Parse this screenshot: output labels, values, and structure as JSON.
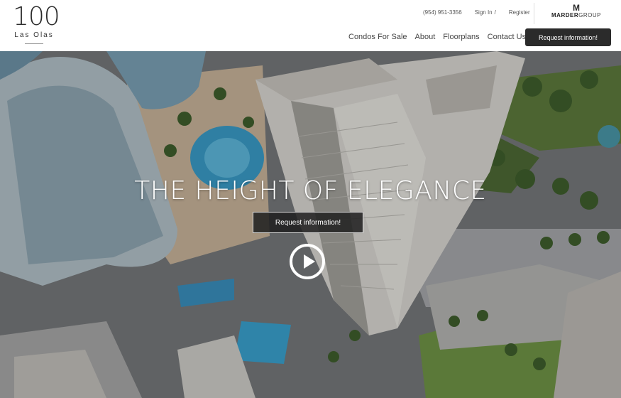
{
  "logo": {
    "number": "100",
    "name": "Las Olas"
  },
  "top_links": {
    "phone": "(954) 951-3356",
    "sign_in": "Sign In",
    "separator": "/",
    "register": "Register"
  },
  "brand": {
    "name_bold": "MARDER",
    "name_rest": "GROUP"
  },
  "nav": {
    "items": [
      "Condos For Sale",
      "About",
      "Floorplans",
      "Contact Us"
    ],
    "cta": "Request information!"
  },
  "hero": {
    "headline": "THE HEIGHT OF ELEGANCE",
    "cta": "Request information!",
    "video_icon": "play-icon"
  }
}
